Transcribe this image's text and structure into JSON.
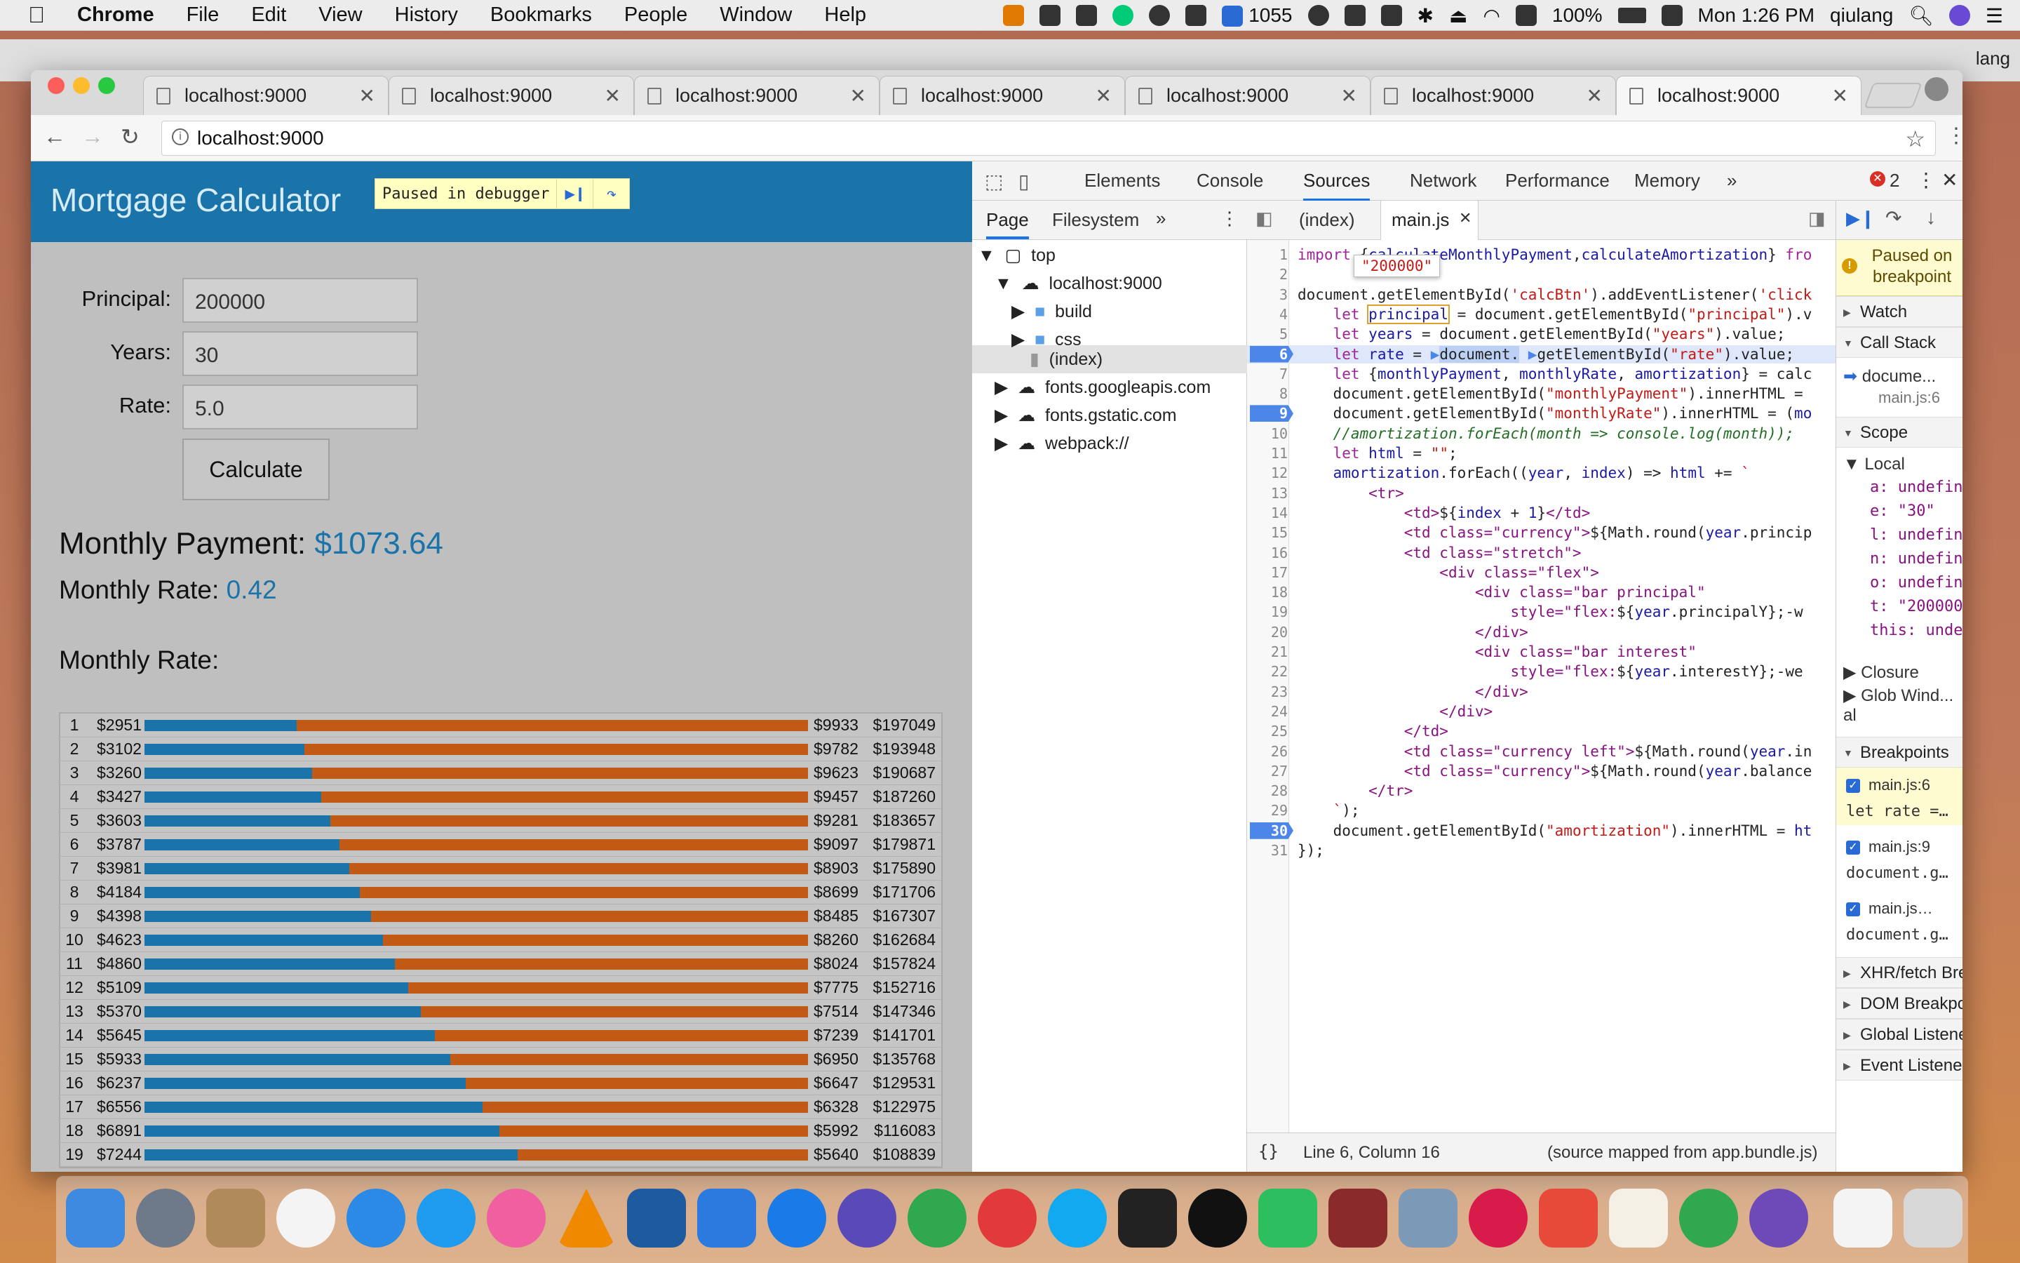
{
  "menubar": {
    "apple": "",
    "app": "Chrome",
    "items": [
      "File",
      "Edit",
      "View",
      "History",
      "Bookmarks",
      "People",
      "Window",
      "Help"
    ],
    "badge_count": "1055",
    "battery": "100%",
    "clock": "Mon 1:26 PM",
    "user": "qiulang"
  },
  "browser": {
    "tabs": [
      "localhost:9000",
      "localhost:9000",
      "localhost:9000",
      "localhost:9000",
      "localhost:9000",
      "localhost:9000",
      "localhost:9000"
    ],
    "address": "localhost:9000",
    "profile_label": "lang"
  },
  "app": {
    "title": "Mortgage Calculator",
    "paused_label": "Paused in debugger",
    "principal_label": "Principal:",
    "principal_value": "200000",
    "years_label": "Years:",
    "years_value": "30",
    "rate_label": "Rate:",
    "rate_value": "5.0",
    "calculate": "Calculate",
    "monthly_payment_label": "Monthly Payment:",
    "monthly_payment_value": "$1073.64",
    "monthly_rate_label": "Monthly Rate:",
    "monthly_rate_value": "0.42",
    "section_label": "Monthly Rate:",
    "amortization": [
      {
        "n": "1",
        "principal": "$2951",
        "interest": "$9933",
        "balance": "$197049",
        "frac": 0.229
      },
      {
        "n": "2",
        "principal": "$3102",
        "interest": "$9782",
        "balance": "$193948",
        "frac": 0.241
      },
      {
        "n": "3",
        "principal": "$3260",
        "interest": "$9623",
        "balance": "$190687",
        "frac": 0.253
      },
      {
        "n": "4",
        "principal": "$3427",
        "interest": "$9457",
        "balance": "$187260",
        "frac": 0.266
      },
      {
        "n": "5",
        "principal": "$3603",
        "interest": "$9281",
        "balance": "$183657",
        "frac": 0.28
      },
      {
        "n": "6",
        "principal": "$3787",
        "interest": "$9097",
        "balance": "$179871",
        "frac": 0.294
      },
      {
        "n": "7",
        "principal": "$3981",
        "interest": "$8903",
        "balance": "$175890",
        "frac": 0.309
      },
      {
        "n": "8",
        "principal": "$4184",
        "interest": "$8699",
        "balance": "$171706",
        "frac": 0.325
      },
      {
        "n": "9",
        "principal": "$4398",
        "interest": "$8485",
        "balance": "$167307",
        "frac": 0.341
      },
      {
        "n": "10",
        "principal": "$4623",
        "interest": "$8260",
        "balance": "$162684",
        "frac": 0.359
      },
      {
        "n": "11",
        "principal": "$4860",
        "interest": "$8024",
        "balance": "$157824",
        "frac": 0.377
      },
      {
        "n": "12",
        "principal": "$5109",
        "interest": "$7775",
        "balance": "$152716",
        "frac": 0.397
      },
      {
        "n": "13",
        "principal": "$5370",
        "interest": "$7514",
        "balance": "$147346",
        "frac": 0.417
      },
      {
        "n": "14",
        "principal": "$5645",
        "interest": "$7239",
        "balance": "$141701",
        "frac": 0.438
      },
      {
        "n": "15",
        "principal": "$5933",
        "interest": "$6950",
        "balance": "$135768",
        "frac": 0.461
      },
      {
        "n": "16",
        "principal": "$6237",
        "interest": "$6647",
        "balance": "$129531",
        "frac": 0.484
      },
      {
        "n": "17",
        "principal": "$6556",
        "interest": "$6328",
        "balance": "$122975",
        "frac": 0.509
      },
      {
        "n": "18",
        "principal": "$6891",
        "interest": "$5992",
        "balance": "$116083",
        "frac": 0.535
      },
      {
        "n": "19",
        "principal": "$7244",
        "interest": "$5640",
        "balance": "$108839",
        "frac": 0.562
      }
    ]
  },
  "devtools": {
    "tabs": [
      "Elements",
      "Console",
      "Sources",
      "Network",
      "Performance",
      "Memory"
    ],
    "active_tab": "Sources",
    "error_count": "2",
    "navigator_tabs": [
      "Page",
      "Filesystem"
    ],
    "tree": [
      "top",
      "localhost:9000",
      "build",
      "css",
      "(index)",
      "fonts.googleapis.com",
      "fonts.gstatic.com",
      "webpack://"
    ],
    "editor_tabs": [
      "(index)",
      "main.js"
    ],
    "tooltip": "\"200000\"",
    "status_position": "Line 6, Column 16",
    "status_source": "(source mapped from app.bundle.js)",
    "paused_banner": "Paused on breakpoint",
    "panes": {
      "watch": "Watch",
      "call_stack": "Call Stack",
      "stack_fn": "docume...",
      "stack_loc": "main.js:6",
      "scope": "Scope",
      "local": "Local",
      "closure": "Closure",
      "global": "Glob Wind... al",
      "breakpoints": "Breakpoints",
      "xhr": "XHR/fetch Bre",
      "dom": "DOM Breakpo",
      "global_listeners": "Global Listene",
      "event_listeners": "Event Listene"
    },
    "scope_vars": [
      "a: undefin",
      "e: \"30\"",
      "l: undefin",
      "n: undefin",
      "o: undefin",
      "t: \"200000",
      "this: unde"
    ],
    "breakpoint_items": [
      {
        "file": "main.js:6",
        "code": "let rate =…"
      },
      {
        "file": "main.js:9",
        "code": "document.g…"
      },
      {
        "file": "main.js…",
        "code": "document.g…"
      }
    ]
  }
}
